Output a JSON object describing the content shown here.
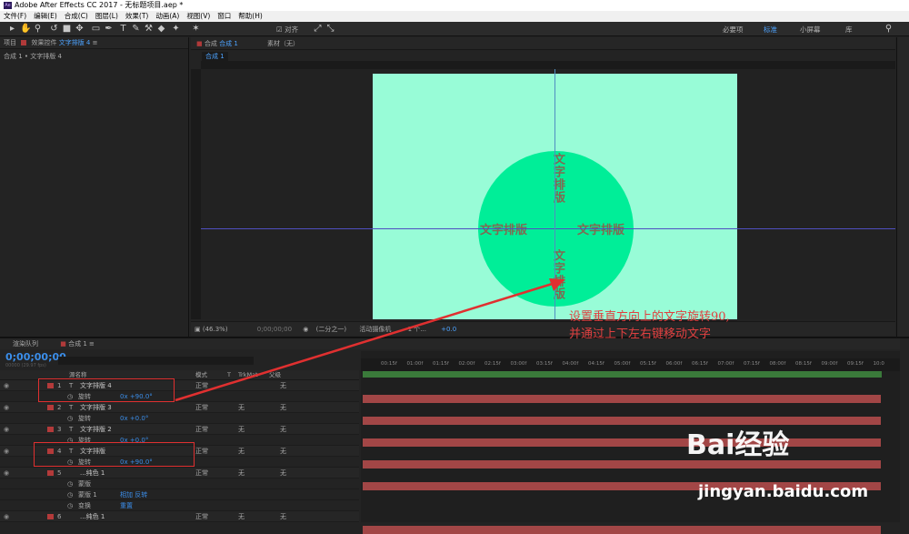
{
  "window": {
    "title": "Adobe After Effects CC 2017 - 无标题项目.aep *",
    "logo": "Ae"
  },
  "menu": [
    "文件(F)",
    "编辑(E)",
    "合成(C)",
    "图层(L)",
    "效果(T)",
    "动画(A)",
    "视图(V)",
    "窗口",
    "帮助(H)"
  ],
  "toolbar": {
    "align_label": "对齐",
    "workspaces": [
      "必要项",
      "标准",
      "小屏幕",
      "库"
    ],
    "active_workspace": "标准"
  },
  "project_panel": {
    "tab_project": "项目",
    "tab_effects_prefix": "效果控件",
    "tab_effects_layer": "文字排版 4",
    "breadcrumb": "合成 1 • 文字排版 4"
  },
  "comp_panel": {
    "tab_label": "合成",
    "tab_comp": "合成 1",
    "tab_footage": "素材（无）",
    "view_label": "合成 1"
  },
  "canvas": {
    "text_center_vertical_top": "文字排版",
    "text_left": "文字排版",
    "text_right": "文字排版",
    "text_center_vertical_bottom": "文字排版",
    "bg_color": "#98fcd7",
    "circle_color": "#00ee98"
  },
  "annotation": {
    "line1": "设置垂直方向上的文字旋转90,",
    "line2": "并通过上下左右键移动文字",
    "color": "#e04040"
  },
  "viewer_bar": {
    "zoom": "(46.3%)",
    "time": "0;00;00;00",
    "resolution": "(二分之一)",
    "camera": "活动摄像机",
    "views": "1 个...",
    "exposure": "+0.0"
  },
  "timeline": {
    "tab_render": "渲染队列",
    "tab_comp": "合成 1",
    "timecode": "0;00;00;00",
    "timecode_sub": "00000 (29.97 fps)",
    "columns": {
      "name": "源名称",
      "mode": "模式",
      "t": "T",
      "trkmat": "TrkMat",
      "parent": "父级"
    },
    "time_ticks": [
      "00:15f",
      "01:00f",
      "01:15f",
      "02:00f",
      "02:15f",
      "03:00f",
      "03:15f",
      "04:00f",
      "04:15f",
      "05:00f",
      "05:15f",
      "06:00f",
      "06:15f",
      "07:00f",
      "07:15f",
      "08:00f",
      "08:15f",
      "09:00f",
      "09:15f",
      "10:0"
    ],
    "rows": [
      {
        "kind": "layer",
        "num": "1",
        "type": "T",
        "name": "文字排版 4",
        "mode": "正常",
        "trk": "",
        "parent": "无"
      },
      {
        "kind": "sub",
        "name": "旋转",
        "value": "0x +90.0°"
      },
      {
        "kind": "layer",
        "num": "2",
        "type": "T",
        "name": "文字排版 3",
        "mode": "正常",
        "trk": "无",
        "parent": "无"
      },
      {
        "kind": "sub",
        "name": "旋转",
        "value": "0x +0.0°"
      },
      {
        "kind": "layer",
        "num": "3",
        "type": "T",
        "name": "文字排版 2",
        "mode": "正常",
        "trk": "无",
        "parent": "无"
      },
      {
        "kind": "sub",
        "name": "旋转",
        "value": "0x +0.0°"
      },
      {
        "kind": "layer",
        "num": "4",
        "type": "T",
        "name": "文字排版",
        "mode": "正常",
        "trk": "无",
        "parent": "无"
      },
      {
        "kind": "sub",
        "name": "旋转",
        "value": "0x +90.0°"
      },
      {
        "kind": "layer",
        "num": "5",
        "type": "",
        "name": "...纯色 1",
        "mode": "正常",
        "trk": "无",
        "parent": "无"
      },
      {
        "kind": "sub",
        "name": "蒙版",
        "value": ""
      },
      {
        "kind": "sub",
        "name": "蒙版 1",
        "value": "相加    反转"
      },
      {
        "kind": "sub",
        "name": "变换",
        "value": "重置"
      },
      {
        "kind": "layer",
        "num": "6",
        "type": "",
        "name": "...纯色 1",
        "mode": "正常",
        "trk": "无",
        "parent": "无"
      }
    ]
  },
  "watermark": {
    "brand": "Bai经验",
    "url": "jingyan.baidu.com"
  }
}
